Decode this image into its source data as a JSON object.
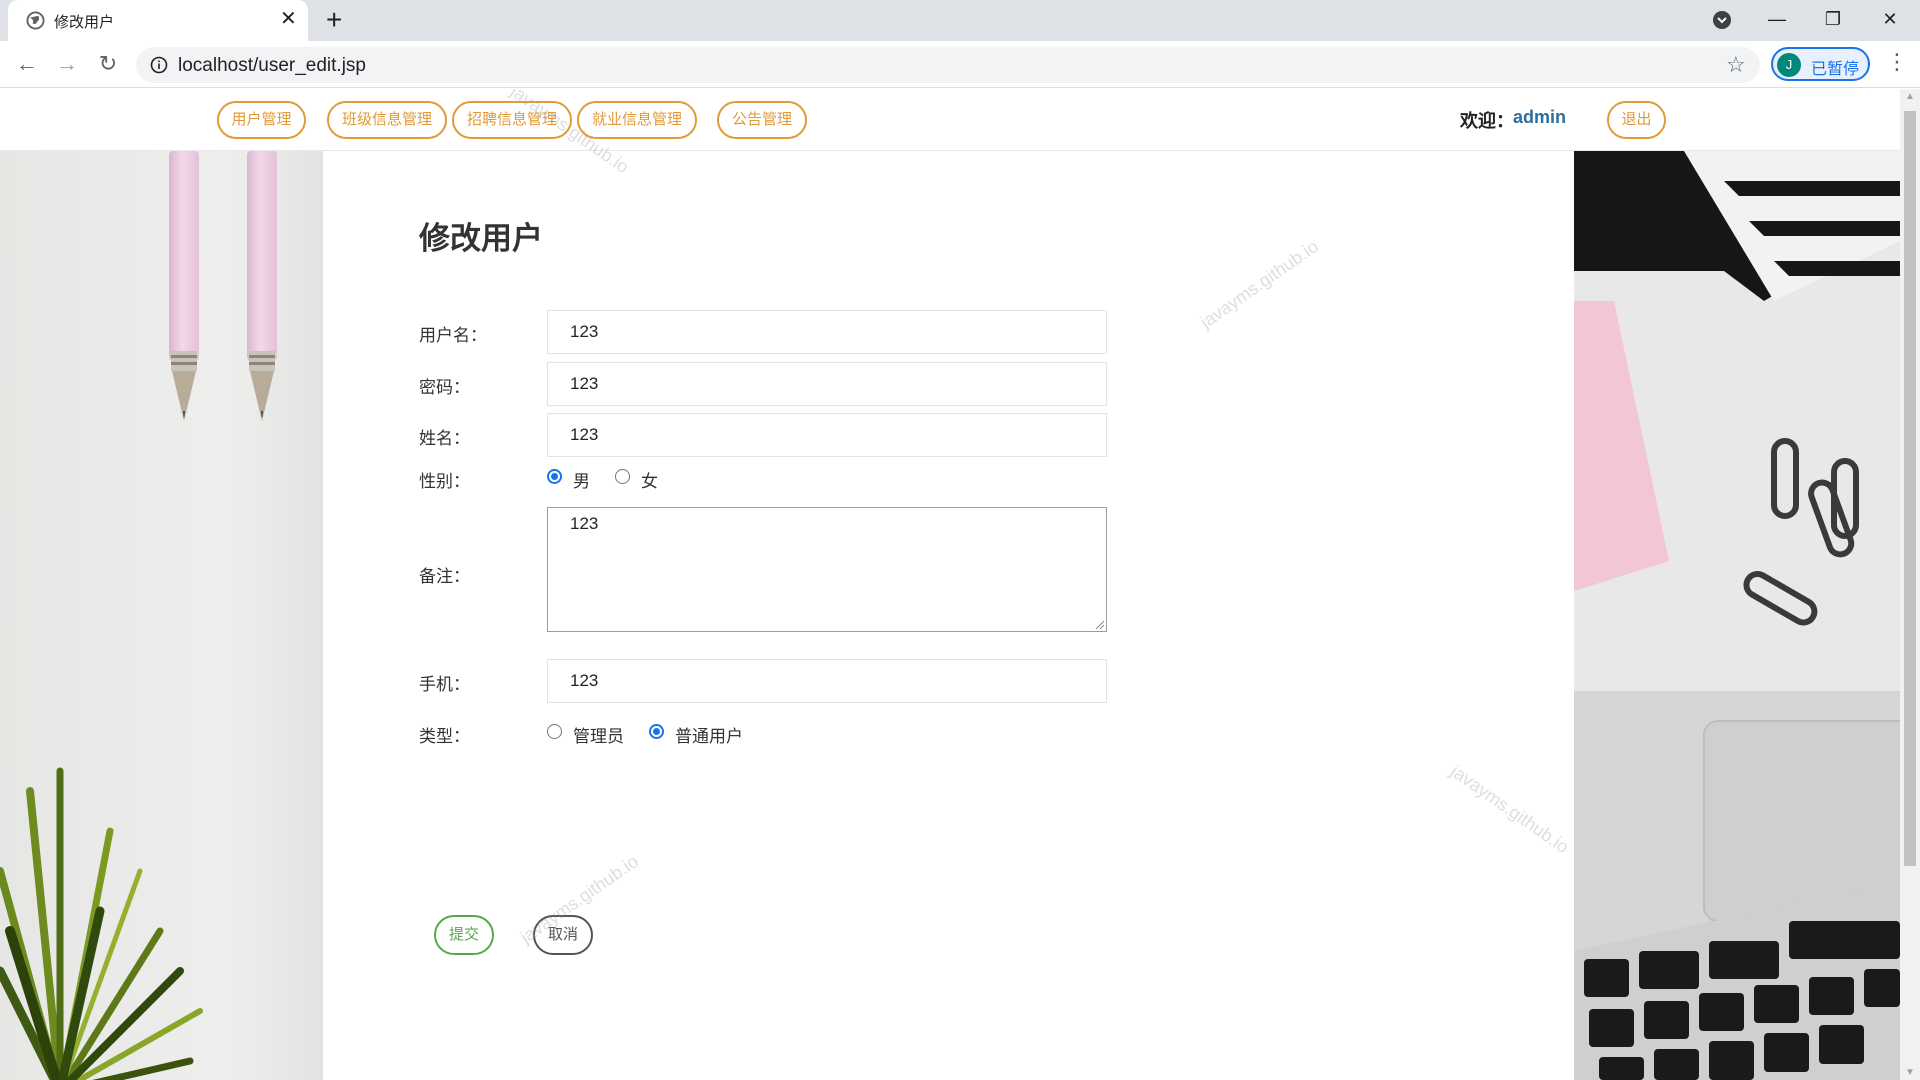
{
  "browser": {
    "tab_title": "修改用户",
    "url": "localhost/user_edit.jsp",
    "profile_initial": "J",
    "profile_status": "已暂停"
  },
  "nav": {
    "items": [
      "用户管理",
      "班级信息管理",
      "招聘信息管理",
      "就业信息管理",
      "公告管理"
    ],
    "welcome_label": "欢迎：",
    "welcome_user": "admin",
    "logout_label": "退出"
  },
  "form": {
    "title": "修改用户",
    "username_label": "用户名：",
    "username_value": "123",
    "password_label": "密码：",
    "password_value": "123",
    "name_label": "姓名：",
    "name_value": "123",
    "gender_label": "性别：",
    "gender_options": [
      "男",
      "女"
    ],
    "gender_selected": "男",
    "remark_label": "备注：",
    "remark_value": "123",
    "phone_label": "手机：",
    "phone_value": "123",
    "type_label": "类型：",
    "type_options": [
      "管理员",
      "普通用户"
    ],
    "type_selected": "普通用户",
    "submit_label": "提交",
    "cancel_label": "取消"
  },
  "watermark_text": "javayms.github.io",
  "colors": {
    "nav_accent": "#e09a3a",
    "submit_accent": "#56a84b",
    "radio_accent": "#1a73e8",
    "welcome_user": "#2c6e9e"
  }
}
